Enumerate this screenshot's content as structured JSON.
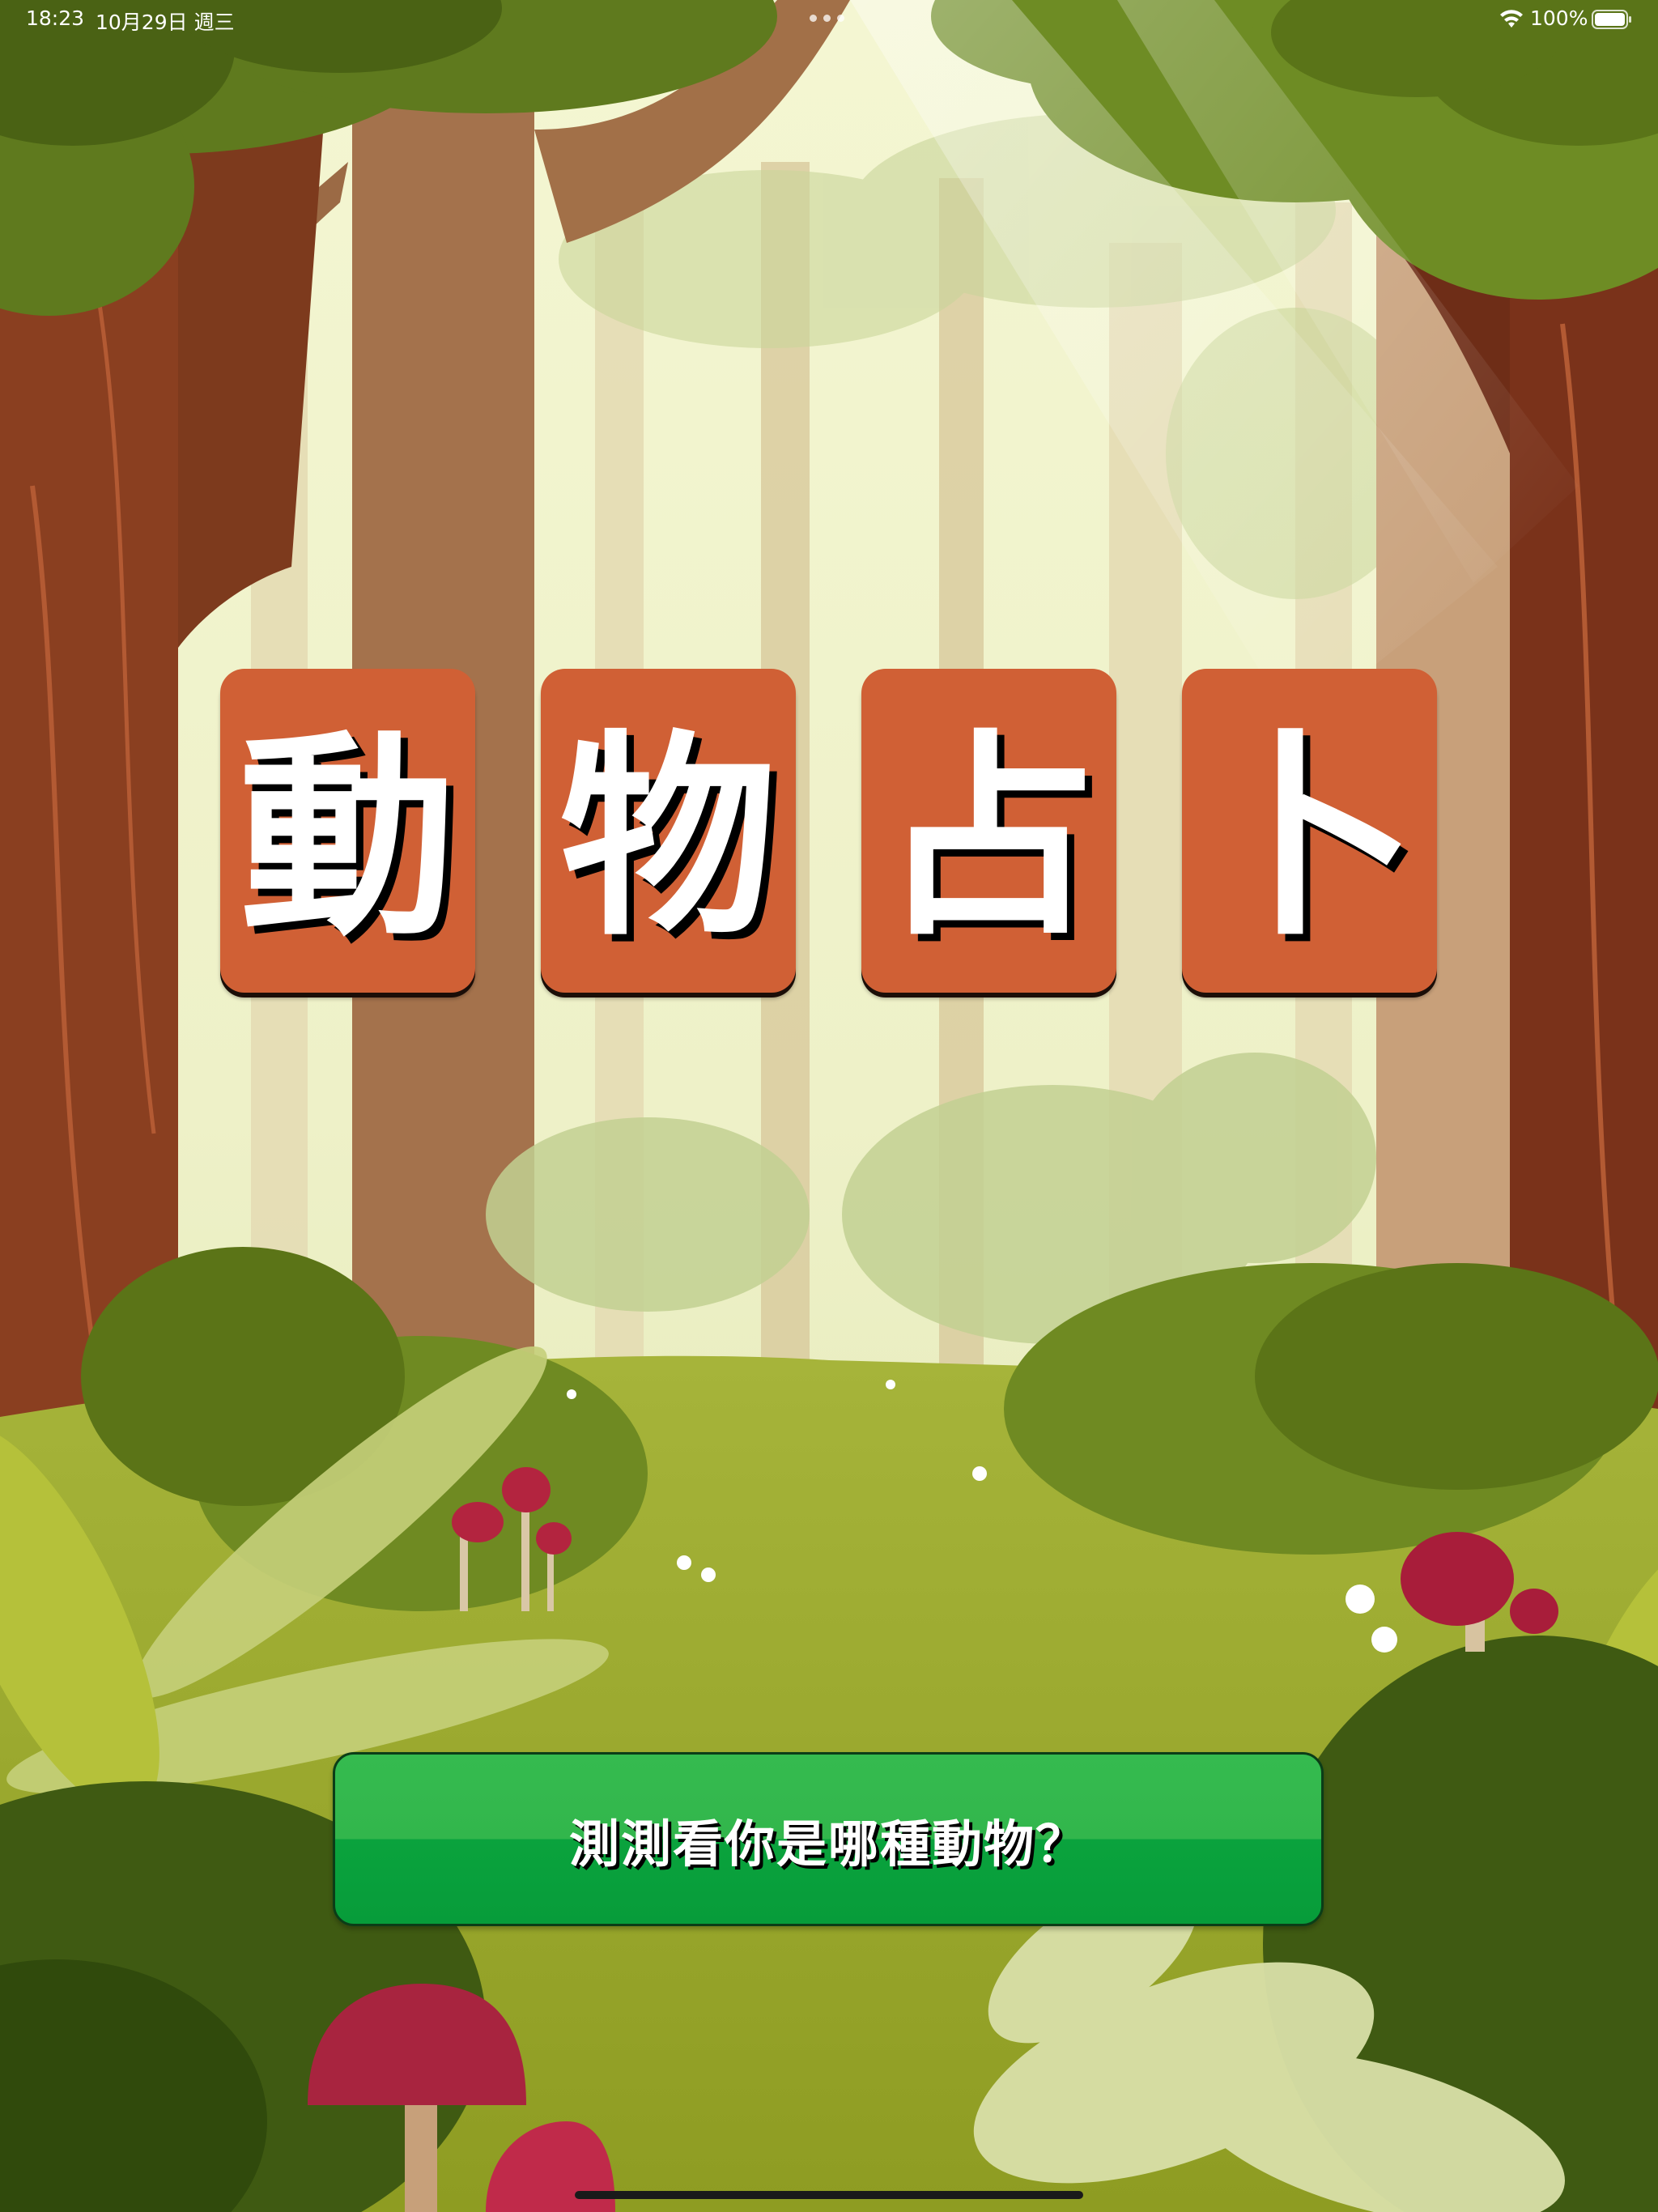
{
  "status_bar": {
    "time": "18:23",
    "date": "10月29日 週三",
    "battery_percent": "100%",
    "wifi_icon": "wifi-icon",
    "battery_icon": "battery-icon",
    "multitask_icon": "multitask-dots-icon"
  },
  "title": {
    "chars": [
      "動",
      "物",
      "占",
      "卜"
    ],
    "tile_color": "#d06035"
  },
  "start_button": {
    "label": "測測看你是哪種動物？",
    "color": "#32b64c"
  },
  "background": {
    "scene": "forest"
  }
}
